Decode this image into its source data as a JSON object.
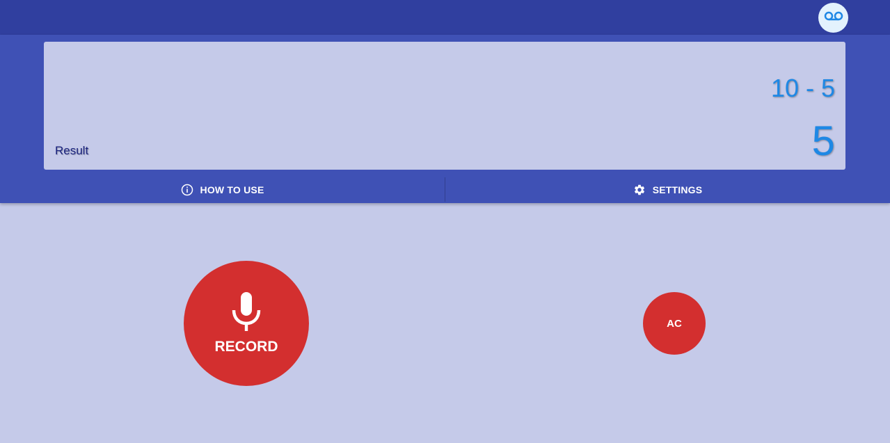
{
  "header": {
    "voicemail_icon": "voicemail-icon"
  },
  "display": {
    "expression": "10 - 5",
    "answer": "5",
    "result_label": "Result"
  },
  "tabs": [
    {
      "label": "HOW TO USE",
      "icon": "info-icon"
    },
    {
      "label": "SETTINGS",
      "icon": "gear-icon"
    }
  ],
  "controls": {
    "record_label": "RECORD",
    "record_icon": "microphone-icon",
    "clear_label": "AC"
  },
  "colors": {
    "topbar": "#303f9f",
    "panel": "#3f51b5",
    "background": "#c5cae9",
    "accent_red": "#d32f2f",
    "display_text": "#1e88e5"
  }
}
